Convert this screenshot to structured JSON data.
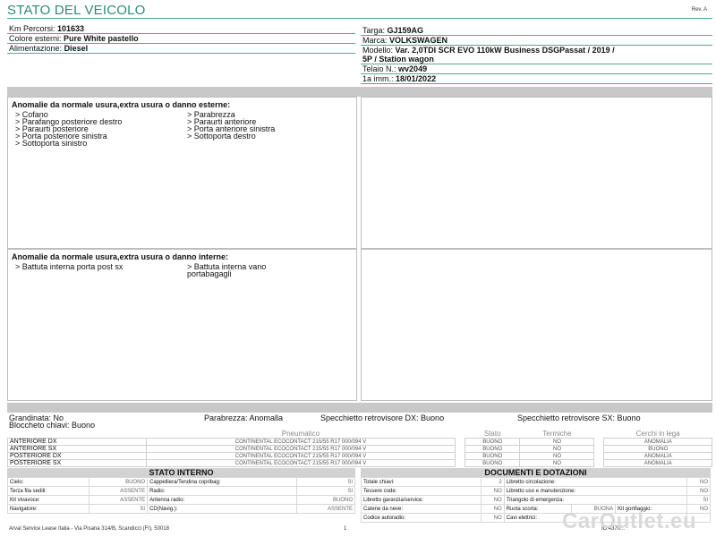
{
  "header": {
    "title": "STATO DEL VEICOLO",
    "rev": "Rev. A"
  },
  "vehicle_left": [
    {
      "label": "Km Percorsi:",
      "value": "101633"
    },
    {
      "label": "Colore esterni:",
      "value": "Pure White pastello"
    },
    {
      "label": "Alimentazione:",
      "value": "Diesel"
    }
  ],
  "vehicle_right": {
    "targa_label": "Targa:",
    "targa": "GJ159AG",
    "marca_label": "Marca:",
    "marca": "VOLKSWAGEN",
    "modello_label": "Modello:",
    "modello_1": "Var. 2,0TDI SCR EVO 110kW Business DSGPassat / 2019 /",
    "modello_2": "5P / Station wagon",
    "telaio_label": "Telaio N.:",
    "telaio": "wv2049",
    "imm_label": "1a imm.:",
    "imm": "18/01/2022"
  },
  "damage_external": {
    "title": "Anomalie da normale usura,extra usura o danno esterne:",
    "col1": [
      "> Cofano",
      "> Parafango posteriore destro",
      "> Paraurti posteriore",
      "> Porta posteriore sinistra",
      "> Sottoporta sinistro"
    ],
    "col2": [
      "> Parabrezza",
      "> Paraurti anteriore",
      "> Porta anteriore sinistra",
      "> Sottoporta destro"
    ]
  },
  "damage_internal": {
    "title": "Anomalie da normale usura,extra usura o danno interne:",
    "col1": [
      "> Battuta interna porta post sx"
    ],
    "col2": [
      "> Battuta interna vano",
      "portabagagli"
    ]
  },
  "summary": {
    "grandinata": "Grandinata: No",
    "parabrezza": "Parabrezza: Anomalla",
    "specchietto_dx": "Specchietto retrovisore DX: Buono",
    "specchietto_sx": "Specchietto retrovisore SX: Buono",
    "bloccheto": "Bloccheto chiavi: Buono"
  },
  "tyres": {
    "headers": [
      "Pneumatico",
      "Stato",
      "Termiche",
      "Cerchi in lega"
    ],
    "rows": [
      {
        "pos": "ANTERIORE DX",
        "tyre": "CONTINENTAL ECOCONTACT 215/55 R17 000/094 V",
        "stato": "BUONO",
        "termiche": "NO",
        "cerchi": "ANOMALIA"
      },
      {
        "pos": "ANTERIORE SX",
        "tyre": "CONTINENTAL ECOCONTACT 215/55 R17 000/094 V",
        "stato": "BUONO",
        "termiche": "NO",
        "cerchi": "BUONO"
      },
      {
        "pos": "POSTERIORE DX",
        "tyre": "CONTINENTAL ECOCONTACT 215/55 R17 000/094 V",
        "stato": "BUONO",
        "termiche": "NO",
        "cerchi": "ANOMALIA"
      },
      {
        "pos": "POSTERIORE SX",
        "tyre": "CONTINENTAL ECOCONTACT 215/55 R17 000/094 V",
        "stato": "BUONO",
        "termiche": "NO",
        "cerchi": "ANOMALIA"
      }
    ]
  },
  "stato_interno": {
    "title": "STATO INTERNO",
    "rows": [
      [
        "Cielo:",
        "BUONO",
        "Cappelliera/Tendina copribag:",
        "SI"
      ],
      [
        "Terza fila sedili:",
        "ASSENTE",
        "Radio:",
        "SI"
      ],
      [
        "Kit vivavoce:",
        "ASSENTE",
        "Antenna radio:",
        "BUONO"
      ],
      [
        "Navigatore:",
        "SI",
        "CD(Navig.):",
        "ASSENTE"
      ]
    ]
  },
  "documenti": {
    "title": "DOCUMENTI E DOTAZIONI",
    "rows": [
      [
        "Totale chiavi:",
        "2",
        "Libretto circolazione:",
        "NO"
      ],
      [
        "Tessere code:",
        "NO",
        "Libretto uso e manutenzione:",
        "NO"
      ],
      [
        "Libretto garanzia/service:",
        "NO",
        "Triangolo di emergenza:",
        "SI"
      ],
      [
        "Catene da neve:",
        "NO",
        "Ruota scorta:",
        "BUONA",
        "Kit gonfiaggio:",
        "NO"
      ],
      [
        "Codice autoradio:",
        "NO",
        "Cavi elettrici:",
        ""
      ]
    ]
  },
  "footer": {
    "company": "Arval Service Lease Italia - Via Pisana 314/B, Scandicci (FI), 50018",
    "page": "1",
    "id": "ID:4370...",
    "watermark": "CarOutlet.eu"
  }
}
